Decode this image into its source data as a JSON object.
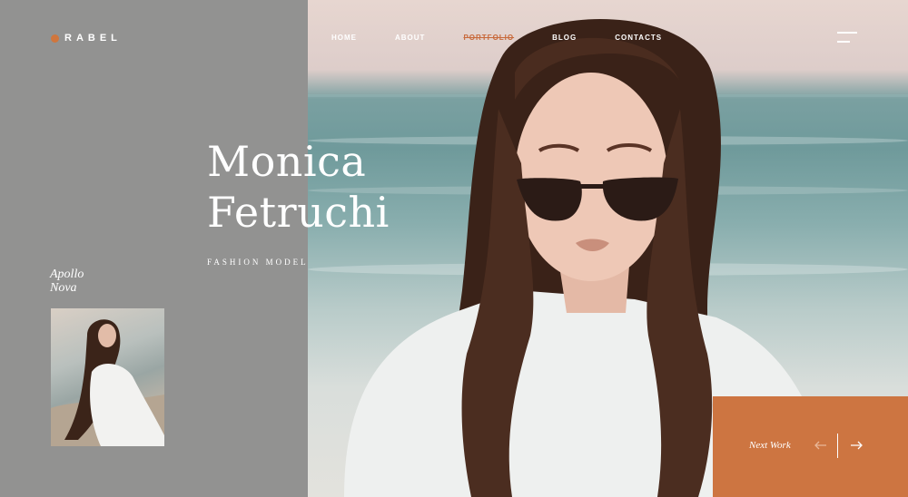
{
  "brand": {
    "name": "RABEL",
    "accent": "#d0763d"
  },
  "nav": {
    "items": [
      {
        "label": "HOME"
      },
      {
        "label": "ABOUT"
      },
      {
        "label": "PORTFOLIO",
        "active": true
      },
      {
        "label": "BLOG"
      },
      {
        "label": "CONTACTS"
      }
    ]
  },
  "hero": {
    "title_line1": "Monica",
    "title_line2": "Fetruchi",
    "subtitle": "FASHION MODEL"
  },
  "side": {
    "caption_line1": "Apollo",
    "caption_line2": "Nova"
  },
  "next_work": {
    "label": "Next Work"
  },
  "icons": {
    "menu": "hamburger-menu-icon",
    "prev": "arrow-left-icon",
    "next": "arrow-right-icon"
  },
  "colors": {
    "left_panel": "#929291",
    "accent_box": "#cd7541",
    "active_nav": "#c8693a"
  }
}
